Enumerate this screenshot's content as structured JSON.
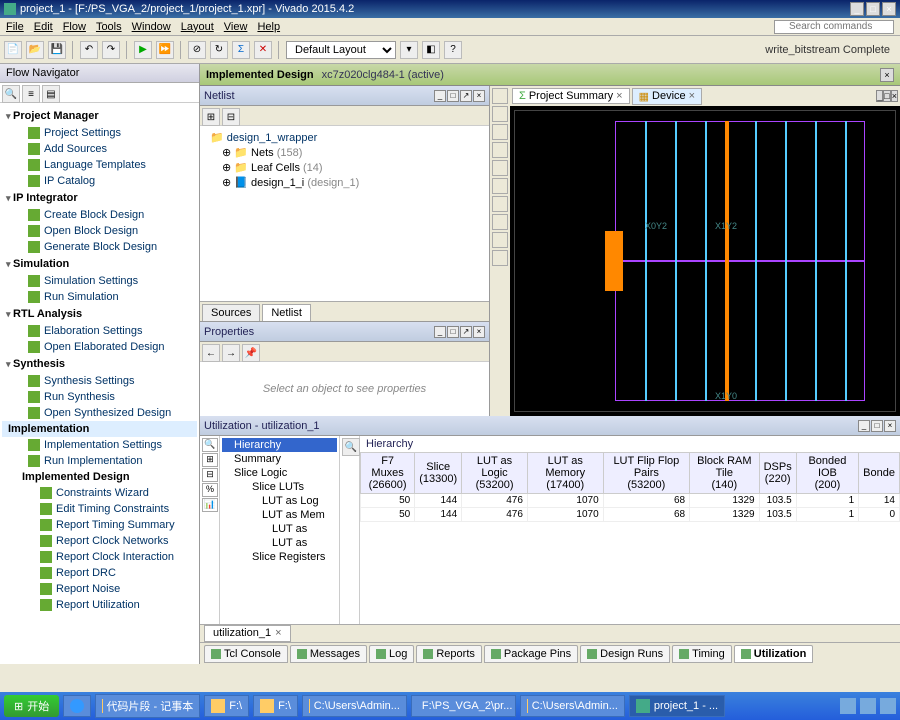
{
  "window": {
    "title": "project_1 - [F:/PS_VGA_2/project_1/project_1.xpr] - Vivado 2015.4.2"
  },
  "menu": {
    "file": "File",
    "edit": "Edit",
    "flow": "Flow",
    "tools": "Tools",
    "window": "Window",
    "layout": "Layout",
    "view": "View",
    "help": "Help"
  },
  "search_placeholder": "Search commands",
  "layout_sel": "Default Layout",
  "status_text": "write_bitstream Complete",
  "flow_nav": {
    "title": "Flow Navigator",
    "pm": "Project Manager",
    "pm_items": [
      "Project Settings",
      "Add Sources",
      "Language Templates",
      "IP Catalog"
    ],
    "ip": "IP Integrator",
    "ip_items": [
      "Create Block Design",
      "Open Block Design",
      "Generate Block Design"
    ],
    "sim": "Simulation",
    "sim_items": [
      "Simulation Settings",
      "Run Simulation"
    ],
    "rtl": "RTL Analysis",
    "rtl_items": [
      "Elaboration Settings",
      "Open Elaborated Design"
    ],
    "syn": "Synthesis",
    "syn_items": [
      "Synthesis Settings",
      "Run Synthesis",
      "Open Synthesized Design"
    ],
    "impl": "Implementation",
    "impl_items": [
      "Implementation Settings",
      "Run Implementation"
    ],
    "impl_design": "Implemented Design",
    "impl_design_items": [
      "Constraints Wizard",
      "Edit Timing Constraints",
      "Report Timing Summary",
      "Report Clock Networks",
      "Report Clock Interaction",
      "Report DRC",
      "Report Noise",
      "Report Utilization"
    ]
  },
  "impl_banner": {
    "title": "Implemented Design",
    "part": "xc7z020clg484-1 (active)"
  },
  "netlist": {
    "title": "Netlist",
    "root": "design_1_wrapper",
    "items": [
      {
        "name": "Nets",
        "count": "(158)"
      },
      {
        "name": "Leaf Cells",
        "count": "(14)"
      },
      {
        "name": "design_1_i",
        "count": "(design_1)"
      }
    ],
    "tab_sources": "Sources",
    "tab_netlist": "Netlist"
  },
  "properties": {
    "title": "Properties",
    "placeholder": "Select an object to see properties"
  },
  "device_tabs": {
    "summary": "Project Summary",
    "device": "Device"
  },
  "device_coords": {
    "x1y2": "X1Y2",
    "x0y2": "X0Y2",
    "x1y0": "X1Y0"
  },
  "util": {
    "title": "Utilization - utilization_1",
    "hierarchy": "Hierarchy",
    "tree": [
      "Hierarchy",
      "Summary",
      "Slice Logic",
      "Slice LUTs",
      "LUT as Log",
      "LUT as Mem",
      "LUT as",
      "LUT as",
      "Slice Registers"
    ],
    "cols": [
      {
        "h": "F7 Muxes",
        "sub": "(26600)"
      },
      {
        "h": "Slice",
        "sub": "(13300)"
      },
      {
        "h": "LUT as Logic",
        "sub": "(53200)"
      },
      {
        "h": "LUT as Memory",
        "sub": "(17400)"
      },
      {
        "h": "LUT Flip Flop Pairs",
        "sub": "(53200)"
      },
      {
        "h": "Block RAM Tile",
        "sub": "(140)"
      },
      {
        "h": "DSPs",
        "sub": "(220)"
      },
      {
        "h": "Bonded IOB",
        "sub": "(200)"
      },
      {
        "h": "Bonde",
        "sub": ""
      }
    ],
    "rows": [
      [
        "50",
        "144",
        "476",
        "1070",
        "68",
        "1329",
        "103.5",
        "1",
        "14"
      ],
      [
        "50",
        "144",
        "476",
        "1070",
        "68",
        "1329",
        "103.5",
        "1",
        "0"
      ]
    ],
    "file_tab": "utilization_1"
  },
  "bottom_tabs": [
    "Tcl Console",
    "Messages",
    "Log",
    "Reports",
    "Package Pins",
    "Design Runs",
    "Timing",
    "Utilization"
  ],
  "taskbar": {
    "start": "开始",
    "items": [
      "代码片段 - 记事本",
      "F:\\",
      "F:\\",
      "C:\\Users\\Admin...",
      "F:\\PS_VGA_2\\pr...",
      "C:\\Users\\Admin...",
      "project_1 - ..."
    ]
  }
}
